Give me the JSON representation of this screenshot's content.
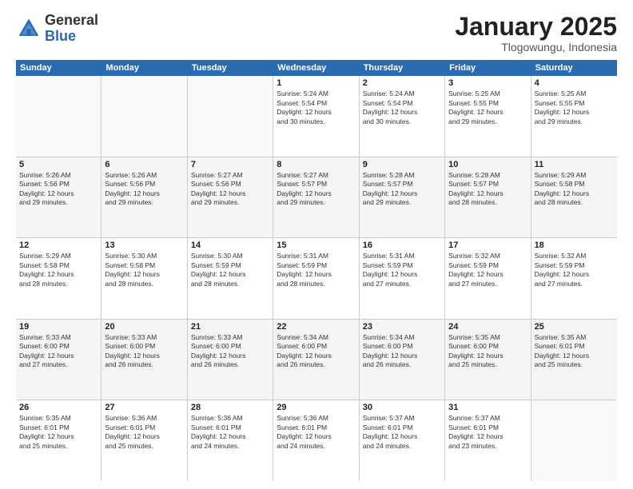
{
  "logo": {
    "general": "General",
    "blue": "Blue"
  },
  "title": {
    "month": "January 2025",
    "location": "Tlogowungu, Indonesia"
  },
  "header": {
    "days": [
      "Sunday",
      "Monday",
      "Tuesday",
      "Wednesday",
      "Thursday",
      "Friday",
      "Saturday"
    ]
  },
  "weeks": [
    [
      {
        "day": "",
        "info": ""
      },
      {
        "day": "",
        "info": ""
      },
      {
        "day": "",
        "info": ""
      },
      {
        "day": "1",
        "info": "Sunrise: 5:24 AM\nSunset: 5:54 PM\nDaylight: 12 hours\nand 30 minutes."
      },
      {
        "day": "2",
        "info": "Sunrise: 5:24 AM\nSunset: 5:54 PM\nDaylight: 12 hours\nand 30 minutes."
      },
      {
        "day": "3",
        "info": "Sunrise: 5:25 AM\nSunset: 5:55 PM\nDaylight: 12 hours\nand 29 minutes."
      },
      {
        "day": "4",
        "info": "Sunrise: 5:25 AM\nSunset: 5:55 PM\nDaylight: 12 hours\nand 29 minutes."
      }
    ],
    [
      {
        "day": "5",
        "info": "Sunrise: 5:26 AM\nSunset: 5:56 PM\nDaylight: 12 hours\nand 29 minutes."
      },
      {
        "day": "6",
        "info": "Sunrise: 5:26 AM\nSunset: 5:56 PM\nDaylight: 12 hours\nand 29 minutes."
      },
      {
        "day": "7",
        "info": "Sunrise: 5:27 AM\nSunset: 5:56 PM\nDaylight: 12 hours\nand 29 minutes."
      },
      {
        "day": "8",
        "info": "Sunrise: 5:27 AM\nSunset: 5:57 PM\nDaylight: 12 hours\nand 29 minutes."
      },
      {
        "day": "9",
        "info": "Sunrise: 5:28 AM\nSunset: 5:57 PM\nDaylight: 12 hours\nand 29 minutes."
      },
      {
        "day": "10",
        "info": "Sunrise: 5:28 AM\nSunset: 5:57 PM\nDaylight: 12 hours\nand 28 minutes."
      },
      {
        "day": "11",
        "info": "Sunrise: 5:29 AM\nSunset: 5:58 PM\nDaylight: 12 hours\nand 28 minutes."
      }
    ],
    [
      {
        "day": "12",
        "info": "Sunrise: 5:29 AM\nSunset: 5:58 PM\nDaylight: 12 hours\nand 28 minutes."
      },
      {
        "day": "13",
        "info": "Sunrise: 5:30 AM\nSunset: 5:58 PM\nDaylight: 12 hours\nand 28 minutes."
      },
      {
        "day": "14",
        "info": "Sunrise: 5:30 AM\nSunset: 5:59 PM\nDaylight: 12 hours\nand 28 minutes."
      },
      {
        "day": "15",
        "info": "Sunrise: 5:31 AM\nSunset: 5:59 PM\nDaylight: 12 hours\nand 28 minutes."
      },
      {
        "day": "16",
        "info": "Sunrise: 5:31 AM\nSunset: 5:59 PM\nDaylight: 12 hours\nand 27 minutes."
      },
      {
        "day": "17",
        "info": "Sunrise: 5:32 AM\nSunset: 5:59 PM\nDaylight: 12 hours\nand 27 minutes."
      },
      {
        "day": "18",
        "info": "Sunrise: 5:32 AM\nSunset: 5:59 PM\nDaylight: 12 hours\nand 27 minutes."
      }
    ],
    [
      {
        "day": "19",
        "info": "Sunrise: 5:33 AM\nSunset: 6:00 PM\nDaylight: 12 hours\nand 27 minutes."
      },
      {
        "day": "20",
        "info": "Sunrise: 5:33 AM\nSunset: 6:00 PM\nDaylight: 12 hours\nand 26 minutes."
      },
      {
        "day": "21",
        "info": "Sunrise: 5:33 AM\nSunset: 6:00 PM\nDaylight: 12 hours\nand 26 minutes."
      },
      {
        "day": "22",
        "info": "Sunrise: 5:34 AM\nSunset: 6:00 PM\nDaylight: 12 hours\nand 26 minutes."
      },
      {
        "day": "23",
        "info": "Sunrise: 5:34 AM\nSunset: 6:00 PM\nDaylight: 12 hours\nand 26 minutes."
      },
      {
        "day": "24",
        "info": "Sunrise: 5:35 AM\nSunset: 6:00 PM\nDaylight: 12 hours\nand 25 minutes."
      },
      {
        "day": "25",
        "info": "Sunrise: 5:35 AM\nSunset: 6:01 PM\nDaylight: 12 hours\nand 25 minutes."
      }
    ],
    [
      {
        "day": "26",
        "info": "Sunrise: 5:35 AM\nSunset: 6:01 PM\nDaylight: 12 hours\nand 25 minutes."
      },
      {
        "day": "27",
        "info": "Sunrise: 5:36 AM\nSunset: 6:01 PM\nDaylight: 12 hours\nand 25 minutes."
      },
      {
        "day": "28",
        "info": "Sunrise: 5:36 AM\nSunset: 6:01 PM\nDaylight: 12 hours\nand 24 minutes."
      },
      {
        "day": "29",
        "info": "Sunrise: 5:36 AM\nSunset: 6:01 PM\nDaylight: 12 hours\nand 24 minutes."
      },
      {
        "day": "30",
        "info": "Sunrise: 5:37 AM\nSunset: 6:01 PM\nDaylight: 12 hours\nand 24 minutes."
      },
      {
        "day": "31",
        "info": "Sunrise: 5:37 AM\nSunset: 6:01 PM\nDaylight: 12 hours\nand 23 minutes."
      },
      {
        "day": "",
        "info": ""
      }
    ]
  ]
}
